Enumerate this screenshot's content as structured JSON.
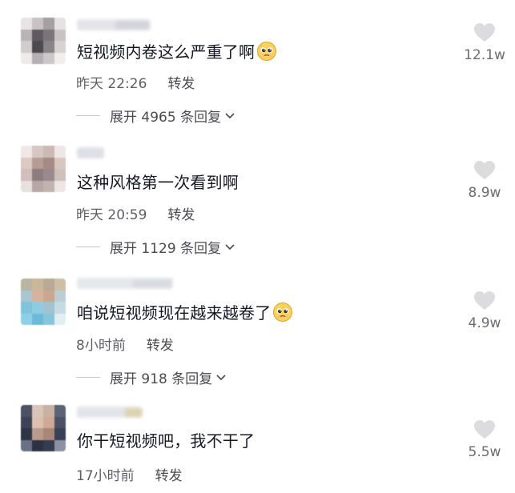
{
  "comments": [
    {
      "text": "短视频内卷这么严重了啊",
      "emoji": "pleading-face",
      "time": "昨天 22:26",
      "reply_label": "转发",
      "expand_label": "展开 4965 条回复",
      "likes": "12.1w"
    },
    {
      "text": "这种风格第一次看到啊",
      "emoji": "",
      "time": "昨天 20:59",
      "reply_label": "转发",
      "expand_label": "展开 1129 条回复",
      "likes": "8.9w"
    },
    {
      "text": "咱说短视频现在越来越卷了",
      "emoji": "pleading-face",
      "time": "8小时前",
      "reply_label": "转发",
      "expand_label": "展开 918 条回复",
      "likes": "4.9w"
    },
    {
      "text": "你干短视频吧，我不干了",
      "emoji": "",
      "time": "17小时前",
      "reply_label": "转发",
      "expand_label": "",
      "likes": "5.5w"
    }
  ],
  "colors": {
    "text": "#161823",
    "meta": "#5e5f66",
    "heart": "#dcdcde"
  }
}
